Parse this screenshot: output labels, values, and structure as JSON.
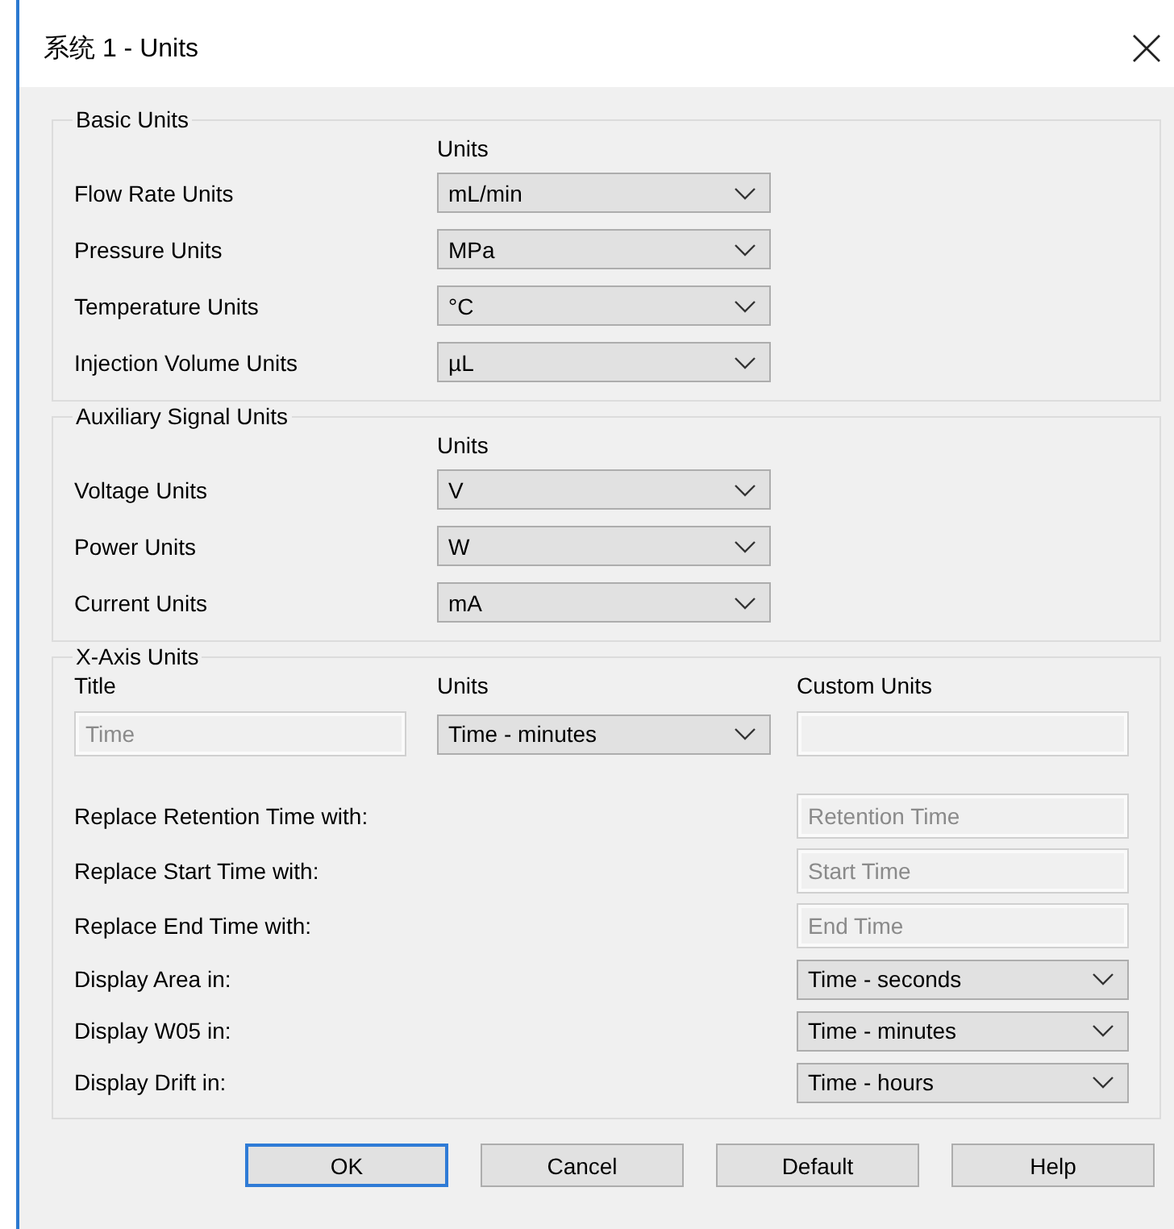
{
  "window": {
    "title": "系统 1 - Units"
  },
  "basic_units": {
    "title": "Basic Units",
    "column_header": "Units",
    "rows": [
      {
        "label": "Flow Rate Units",
        "value": "mL/min"
      },
      {
        "label": "Pressure Units",
        "value": "MPa"
      },
      {
        "label": "Temperature Units",
        "value": "°C"
      },
      {
        "label": "Injection Volume Units",
        "value": "µL"
      }
    ]
  },
  "auxiliary_signal_units": {
    "title": "Auxiliary Signal Units",
    "column_header": "Units",
    "rows": [
      {
        "label": "Voltage Units",
        "value": "V"
      },
      {
        "label": "Power Units",
        "value": "W"
      },
      {
        "label": "Current Units",
        "value": "mA"
      }
    ]
  },
  "x_axis_units": {
    "title": "X-Axis Units",
    "headers": [
      "Title",
      "Units",
      "Custom Units"
    ],
    "title_field": {
      "value": "Time",
      "disabled": true
    },
    "units_dropdown": {
      "value": "Time - minutes"
    },
    "custom_units_field": {
      "disabled": true
    },
    "replace_rows": [
      {
        "label": "Replace Retention Time with:",
        "value": "Retention Time",
        "disabled": true
      },
      {
        "label": "Replace Start Time with:",
        "value": "Start Time",
        "disabled": true
      },
      {
        "label": "Replace End Time with:",
        "value": "End Time",
        "disabled": true
      }
    ],
    "display_rows": [
      {
        "label": "Display Area in:",
        "value": "Time - seconds"
      },
      {
        "label": "Display W05 in:",
        "value": "Time - minutes"
      },
      {
        "label": "Display Drift in:",
        "value": "Time - hours"
      }
    ]
  },
  "buttons": [
    {
      "label": "OK",
      "default": true
    },
    {
      "label": "Cancel",
      "default": false
    },
    {
      "label": "Default",
      "default": false
    },
    {
      "label": "Help",
      "default": false
    }
  ]
}
